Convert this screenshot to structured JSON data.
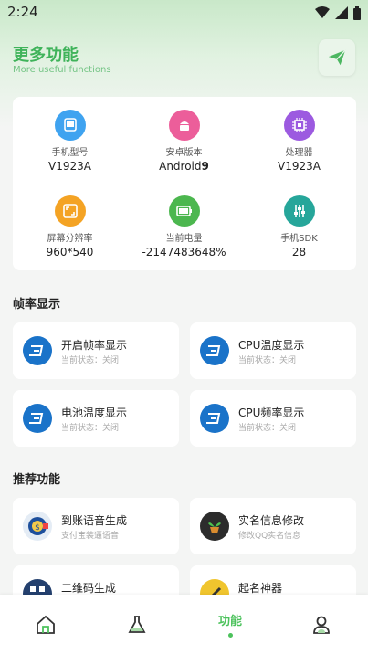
{
  "status": {
    "time": "2:24"
  },
  "header": {
    "title": "更多功能",
    "subtitle": "More useful functions",
    "send_icon": "send-icon"
  },
  "device_info": [
    {
      "label": "手机型号",
      "value": "V1923A",
      "icon": "phone-icon",
      "color": "#3fa3f0"
    },
    {
      "label": "安卓版本",
      "value": "Android",
      "value_bold": "9",
      "icon": "android-icon",
      "color": "#ec5e9a"
    },
    {
      "label": "处理器",
      "value": "V1923A",
      "icon": "cpu-icon",
      "color": "#9c5ae0"
    },
    {
      "label": "屏幕分辨率",
      "value": "960*540",
      "icon": "screen-icon",
      "color": "#f4a324"
    },
    {
      "label": "当前电量",
      "value": "-2147483648%",
      "icon": "battery-icon",
      "color": "#4cb74f"
    },
    {
      "label": "手机SDK",
      "value": "28",
      "icon": "sliders-icon",
      "color": "#26a69a"
    }
  ],
  "sections": {
    "fps": {
      "title": "帧率显示",
      "items": [
        {
          "title": "开启帧率显示",
          "subtitle": "当前状态：关闭"
        },
        {
          "title": "CPU温度显示",
          "subtitle": "当前状态：关闭"
        },
        {
          "title": "电池温度显示",
          "subtitle": "当前状态：关闭"
        },
        {
          "title": "CPU频率显示",
          "subtitle": "当前状态：关闭"
        }
      ]
    },
    "recommended": {
      "title": "推荐功能",
      "items": [
        {
          "title": "到账语音生成",
          "subtitle": "支付宝装逼语音"
        },
        {
          "title": "实名信息修改",
          "subtitle": "修改QQ实名信息"
        },
        {
          "title": "二维码生成",
          "subtitle": ""
        },
        {
          "title": "起名神器",
          "subtitle": ""
        }
      ]
    }
  },
  "nav": {
    "items": [
      {
        "icon": "home-icon"
      },
      {
        "icon": "flask-icon"
      },
      {
        "label": "功能",
        "active": true
      },
      {
        "icon": "user-icon"
      }
    ]
  },
  "colors": {
    "accent": "#4cc25c",
    "dash_blue": "#1a73c9"
  }
}
